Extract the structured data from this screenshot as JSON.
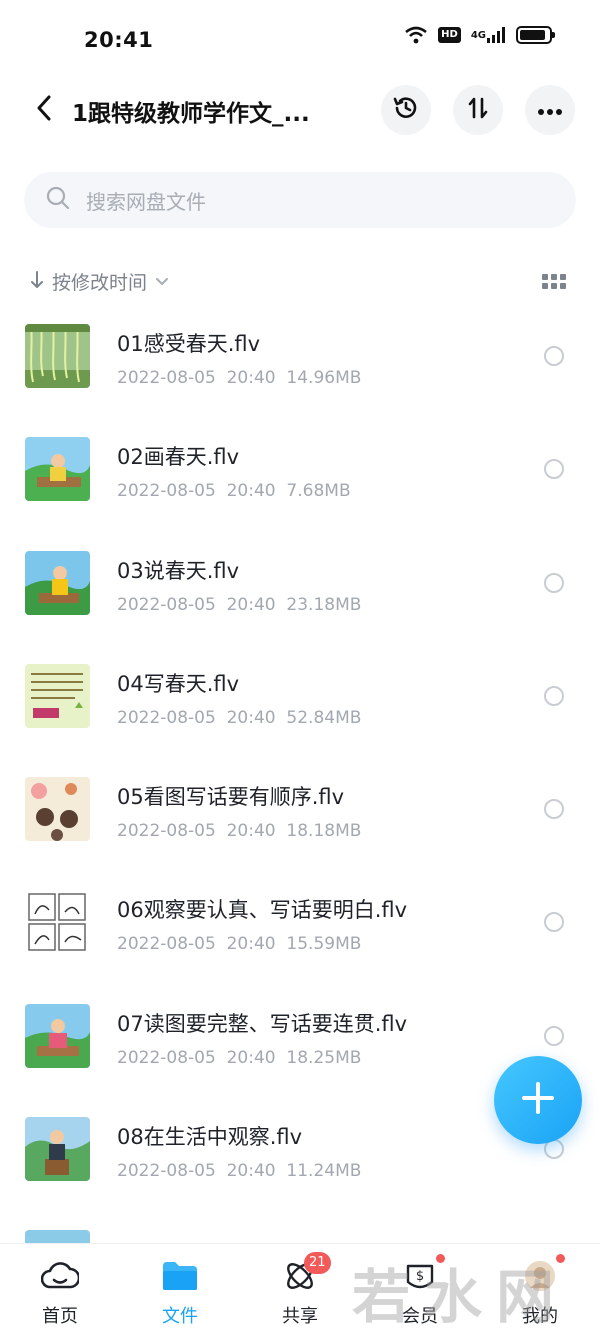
{
  "status_bar": {
    "time": "20:41",
    "hd": "HD",
    "network": "4G",
    "battery_level": 0.9,
    "icons": [
      "wifi-icon",
      "signal-icon",
      "battery-icon"
    ]
  },
  "header": {
    "title": "1跟特级教师学作文_...",
    "back_icon": "chevron-left-icon",
    "history_icon": "history-icon",
    "sort_icon": "sort-arrows-icon",
    "more_icon": "more-dots-icon"
  },
  "search": {
    "placeholder": "搜索网盘文件"
  },
  "sort": {
    "label": "按修改时间"
  },
  "files": [
    {
      "name": "01感受春天.flv",
      "date": "2022-08-05",
      "time": "20:40",
      "size": "14.96MB"
    },
    {
      "name": "02画春天.flv",
      "date": "2022-08-05",
      "time": "20:40",
      "size": "7.68MB"
    },
    {
      "name": "03说春天.flv",
      "date": "2022-08-05",
      "time": "20:40",
      "size": "23.18MB"
    },
    {
      "name": "04写春天.flv",
      "date": "2022-08-05",
      "time": "20:40",
      "size": "52.84MB"
    },
    {
      "name": "05看图写话要有顺序.flv",
      "date": "2022-08-05",
      "time": "20:40",
      "size": "18.18MB"
    },
    {
      "name": "06观察要认真、写话要明白.flv",
      "date": "2022-08-05",
      "time": "20:40",
      "size": "15.59MB"
    },
    {
      "name": "07读图要完整、写话要连贯.flv",
      "date": "2022-08-05",
      "time": "20:40",
      "size": "18.25MB"
    },
    {
      "name": "08在生活中观察.flv",
      "date": "2022-08-05",
      "time": "20:40",
      "size": "11.24MB"
    }
  ],
  "nav": {
    "items": [
      {
        "label": "首页",
        "icon": "cloud-home-icon"
      },
      {
        "label": "文件",
        "icon": "folder-icon"
      },
      {
        "label": "共享",
        "icon": "share-atom-icon",
        "badge": "21"
      },
      {
        "label": "会员",
        "icon": "vip-coin-icon"
      },
      {
        "label": "我的",
        "icon": "profile-icon"
      }
    ]
  },
  "watermark": "若水网",
  "colors": {
    "accent": "#1aa3f5",
    "badge": "#f25a5a",
    "meta_text": "#a3a8b0"
  }
}
